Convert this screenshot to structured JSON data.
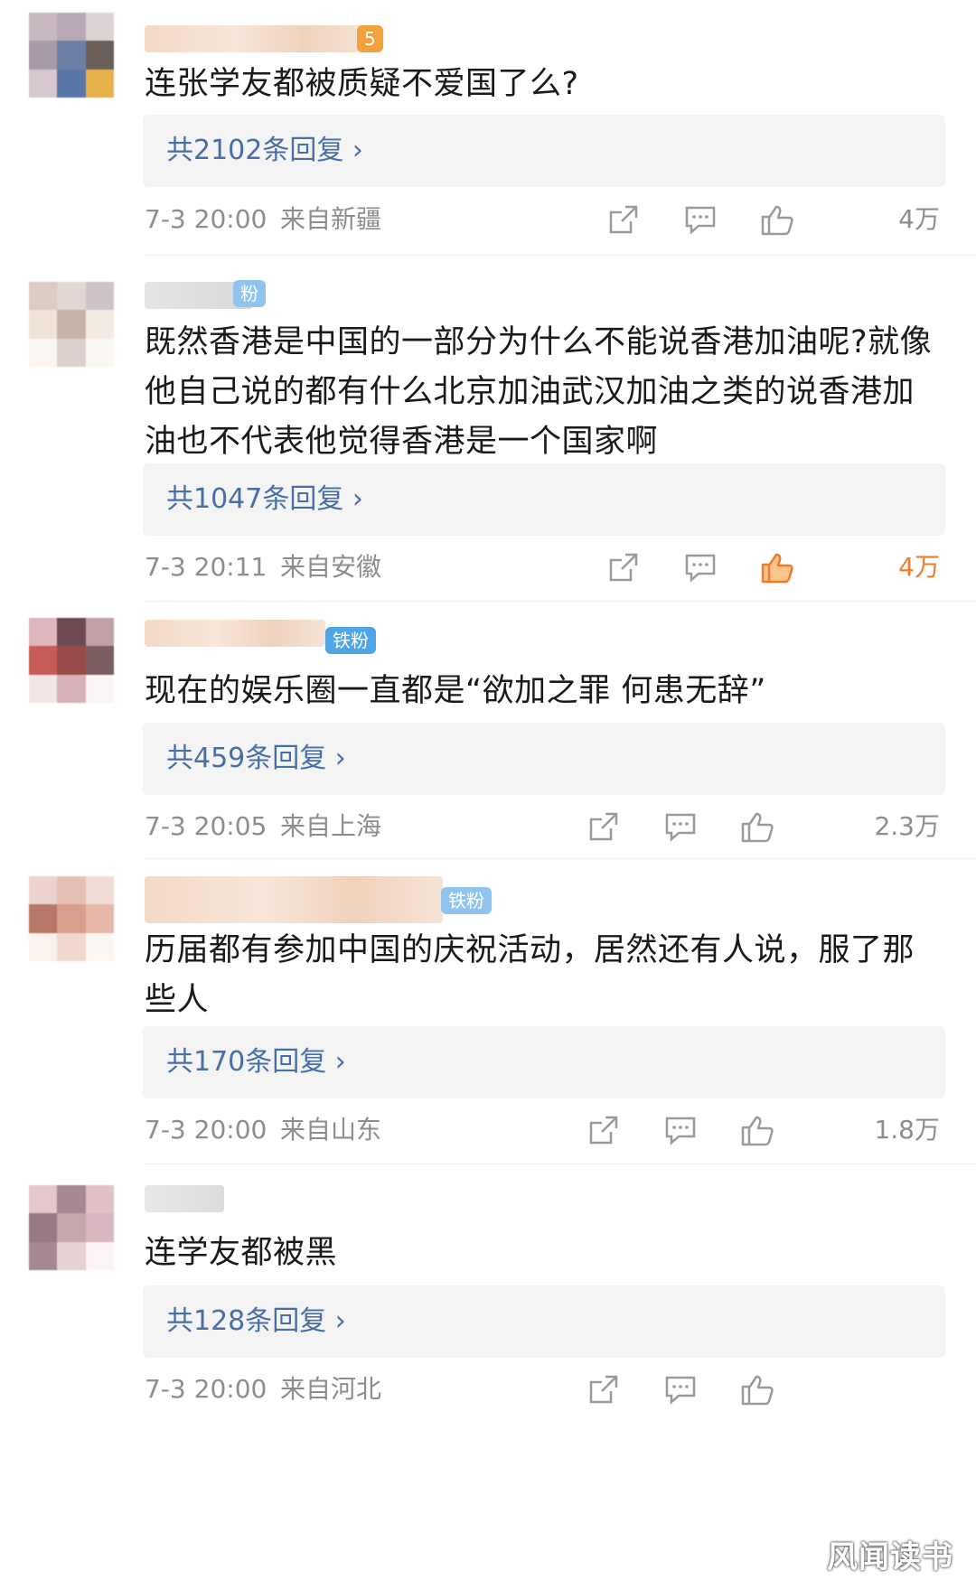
{
  "comments": [
    {
      "text": "连张学友都被质疑不爱国了么?",
      "replies": "共2102条回复 ›",
      "time": "7-3 20:00",
      "location": "来自新疆",
      "likes": "4万",
      "liked": false,
      "badge": "5"
    },
    {
      "text": "既然香港是中国的一部分为什么不能说香港加油呢?就像他自己说的都有什么北京加油武汉加油之类的说香港加油也不代表他觉得香港是一个国家啊",
      "replies": "共1047条回复 ›",
      "time": "7-3 20:11",
      "location": "来自安徽",
      "likes": "4万",
      "liked": true,
      "badge": "粉"
    },
    {
      "text": "现在的娱乐圈一直都是“欲加之罪 何患无辞”",
      "replies": "共459条回复 ›",
      "time": "7-3 20:05",
      "location": "来自上海",
      "likes": "2.3万",
      "liked": false,
      "badge": "铁粉"
    },
    {
      "text": "历届都有参加中国的庆祝活动，居然还有人说，服了那些人",
      "replies": "共170条回复 ›",
      "time": "7-3 20:00",
      "location": "来自山东",
      "likes": "1.8万",
      "liked": false,
      "badge": "铁粉"
    },
    {
      "text": "连学友都被黑",
      "replies": "共128条回复 ›",
      "time": "7-3 20:00",
      "location": "来自河北",
      "likes": "",
      "liked": false,
      "badge": ""
    }
  ],
  "icons": {
    "share": "share-icon",
    "comment": "comment-icon",
    "like": "thumbs-up-icon"
  },
  "colors": {
    "reply_link": "#486ea8",
    "liked": "#f07c2a",
    "meta": "#8d8d8d"
  },
  "watermark": "风闻读书"
}
